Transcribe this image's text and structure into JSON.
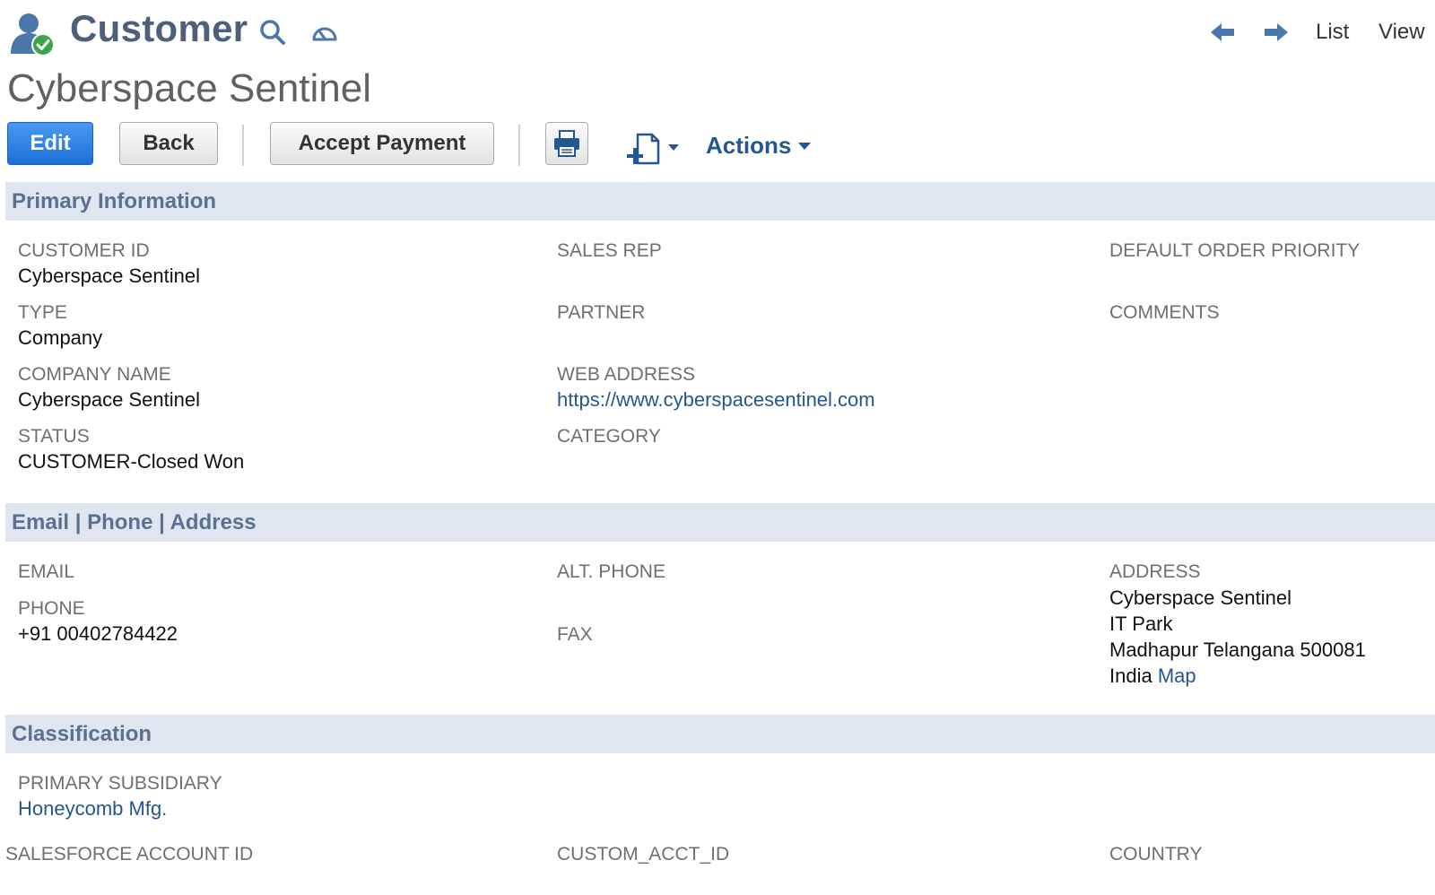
{
  "header": {
    "record_type": "Customer",
    "icon": "customer-verified-icon",
    "nav": {
      "list_label": "List",
      "view_label": "View"
    }
  },
  "record": {
    "title": "Cyberspace Sentinel"
  },
  "toolbar": {
    "edit_label": "Edit",
    "back_label": "Back",
    "accept_payment_label": "Accept Payment",
    "actions_label": "Actions"
  },
  "sections": {
    "primary": {
      "title": "Primary Information",
      "customer_id": {
        "label": "CUSTOMER ID",
        "value": "Cyberspace Sentinel"
      },
      "type": {
        "label": "TYPE",
        "value": "Company"
      },
      "company_name": {
        "label": "COMPANY NAME",
        "value": "Cyberspace Sentinel"
      },
      "status": {
        "label": "STATUS",
        "value": "CUSTOMER-Closed Won"
      },
      "sales_rep": {
        "label": "SALES REP"
      },
      "partner": {
        "label": "PARTNER"
      },
      "web_address": {
        "label": "WEB ADDRESS",
        "value": "https://www.cyberspacesentinel.com"
      },
      "category": {
        "label": "CATEGORY"
      },
      "default_order_priority": {
        "label": "DEFAULT ORDER PRIORITY"
      },
      "comments": {
        "label": "COMMENTS"
      }
    },
    "contact": {
      "title": "Email | Phone | Address",
      "email": {
        "label": "EMAIL"
      },
      "phone": {
        "label": "PHONE",
        "value": "+91 00402784422"
      },
      "alt_phone": {
        "label": "ALT. PHONE"
      },
      "fax": {
        "label": "FAX"
      },
      "address": {
        "label": "ADDRESS",
        "line1": "Cyberspace Sentinel",
        "line2": "IT Park",
        "line3": "Madhapur Telangana 500081",
        "country": "India",
        "map_link": "Map"
      }
    },
    "classification": {
      "title": "Classification",
      "primary_subsidiary": {
        "label": "PRIMARY SUBSIDIARY",
        "value": "Honeycomb Mfg."
      },
      "salesforce_account_id": {
        "label": "SALESFORCE ACCOUNT ID"
      },
      "custom_acct_id": {
        "label": "CUSTOM_ACCT_ID"
      },
      "country": {
        "label": "COUNTRY"
      }
    }
  },
  "colors": {
    "brand_text": "#4d5f79",
    "section_bg": "#e0e6ef",
    "section_title": "#5a7192",
    "link": "#24578f",
    "primary_button": "#1b6fd9"
  }
}
